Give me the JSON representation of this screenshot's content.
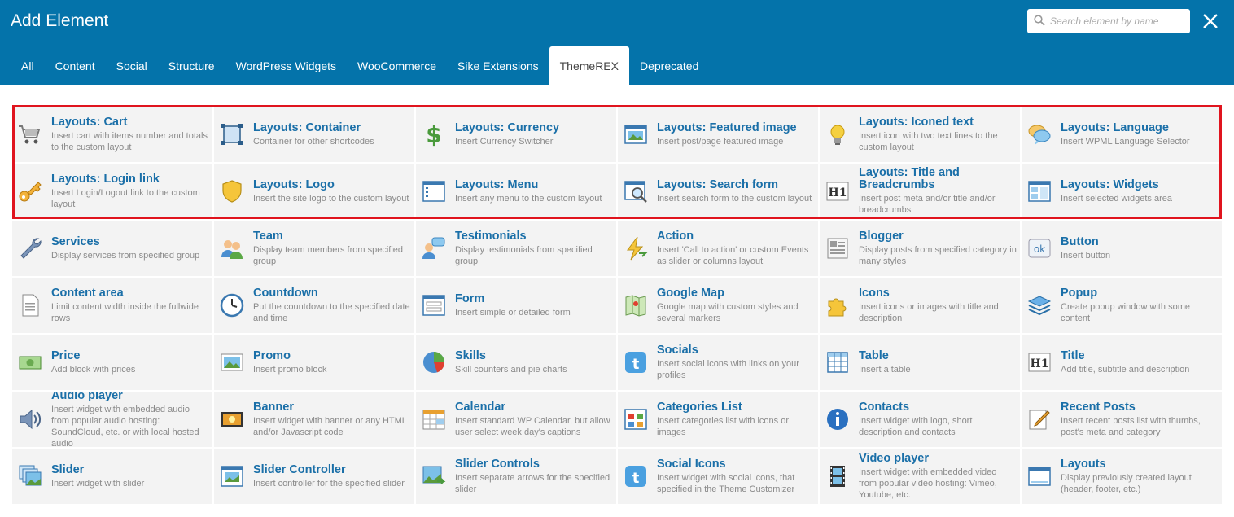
{
  "header": {
    "title": "Add Element",
    "search_placeholder": "Search element by name"
  },
  "tabs": [
    "All",
    "Content",
    "Social",
    "Structure",
    "WordPress Widgets",
    "WooCommerce",
    "Sike Extensions",
    "ThemeREX",
    "Deprecated"
  ],
  "active_tab": "ThemeREX",
  "colors": {
    "header": "#0473aa",
    "link": "#1a6fa8",
    "highlight": "#e0141e"
  },
  "elements": [
    {
      "name": "Layouts: Cart",
      "desc": "Insert cart with items number and totals to the custom layout",
      "icon": "cart-icon"
    },
    {
      "name": "Layouts: Container",
      "desc": "Container for other shortcodes",
      "icon": "container-icon"
    },
    {
      "name": "Layouts: Currency",
      "desc": "Insert Currency Switcher",
      "icon": "dollar-icon"
    },
    {
      "name": "Layouts: Featured image",
      "desc": "Insert post/page featured image",
      "icon": "image-window-icon"
    },
    {
      "name": "Layouts: Iconed text",
      "desc": "Insert icon with two text lines to the custom layout",
      "icon": "bulb-icon"
    },
    {
      "name": "Layouts: Language",
      "desc": "Insert WPML Language Selector",
      "icon": "speech-bubbles-icon"
    },
    {
      "name": "Layouts: Login link",
      "desc": "Insert Login/Logout link to the custom layout",
      "icon": "key-icon"
    },
    {
      "name": "Layouts: Logo",
      "desc": "Insert the site logo to the custom layout",
      "icon": "shield-icon"
    },
    {
      "name": "Layouts: Menu",
      "desc": "Insert any menu to the custom layout",
      "icon": "menu-window-icon"
    },
    {
      "name": "Layouts: Search form",
      "desc": "Insert search form to the custom layout",
      "icon": "search-window-icon"
    },
    {
      "name": "Layouts: Title and Breadcrumbs",
      "desc": "Insert post meta and/or title and/or breadcrumbs",
      "icon": "h1-icon"
    },
    {
      "name": "Layouts: Widgets",
      "desc": "Insert selected widgets area",
      "icon": "widgets-window-icon"
    },
    {
      "name": "Services",
      "desc": "Display services from specified group",
      "icon": "wrench-icon"
    },
    {
      "name": "Team",
      "desc": "Display team members from specified group",
      "icon": "users-icon"
    },
    {
      "name": "Testimonials",
      "desc": "Display testimonials from specified group",
      "icon": "user-comment-icon"
    },
    {
      "name": "Action",
      "desc": "Insert 'Call to action' or custom Events as slider or columns layout",
      "icon": "lightning-icon"
    },
    {
      "name": "Blogger",
      "desc": "Display posts from specified category in many styles",
      "icon": "newspaper-icon"
    },
    {
      "name": "Button",
      "desc": "Insert button",
      "icon": "ok-button-icon"
    },
    {
      "name": "Content area",
      "desc": "Limit content width inside the fullwide rows",
      "icon": "document-icon"
    },
    {
      "name": "Countdown",
      "desc": "Put the countdown to the specified date and time",
      "icon": "clock-icon"
    },
    {
      "name": "Form",
      "desc": "Insert simple or detailed form",
      "icon": "form-window-icon"
    },
    {
      "name": "Google Map",
      "desc": "Google map with custom styles and several markers",
      "icon": "map-icon"
    },
    {
      "name": "Icons",
      "desc": "Insert icons or images with title and description",
      "icon": "puzzle-icon"
    },
    {
      "name": "Popup",
      "desc": "Create popup window with some content",
      "icon": "layers-icon"
    },
    {
      "name": "Price",
      "desc": "Add block with prices",
      "icon": "money-icon"
    },
    {
      "name": "Promo",
      "desc": "Insert promo block",
      "icon": "picture-icon"
    },
    {
      "name": "Skills",
      "desc": "Skill counters and pie charts",
      "icon": "pie-chart-icon"
    },
    {
      "name": "Socials",
      "desc": "Insert social icons with links on your profiles",
      "icon": "twitter-icon"
    },
    {
      "name": "Table",
      "desc": "Insert a table",
      "icon": "table-icon"
    },
    {
      "name": "Title",
      "desc": "Add title, subtitle and description",
      "icon": "h1-icon"
    },
    {
      "name": "Audio player",
      "desc": "Insert widget with embedded audio from popular audio hosting: SoundCloud, etc. or with local hosted audio",
      "icon": "speaker-icon"
    },
    {
      "name": "Banner",
      "desc": "Insert widget with banner or any HTML and/or Javascript code",
      "icon": "banner-icon"
    },
    {
      "name": "Calendar",
      "desc": "Insert standard WP Calendar, but allow user select week day's captions",
      "icon": "calendar-icon"
    },
    {
      "name": "Categories List",
      "desc": "Insert categories list with icons or images",
      "icon": "categories-icon"
    },
    {
      "name": "Contacts",
      "desc": "Insert widget with logo, short description and contacts",
      "icon": "info-icon"
    },
    {
      "name": "Recent Posts",
      "desc": "Insert recent posts list with thumbs, post's meta and category",
      "icon": "pen-paper-icon"
    },
    {
      "name": "Slider",
      "desc": "Insert widget with slider",
      "icon": "slides-icon"
    },
    {
      "name": "Slider Controller",
      "desc": "Insert controller for the specified slider",
      "icon": "slider-window-icon"
    },
    {
      "name": "Slider Controls",
      "desc": "Insert separate arrows for the specified slider",
      "icon": "slider-arrows-icon"
    },
    {
      "name": "Social Icons",
      "desc": "Insert widget with social icons, that specified in the Theme Customizer",
      "icon": "twitter-icon"
    },
    {
      "name": "Video player",
      "desc": "Insert widget with embedded video from popular video hosting: Vimeo, Youtube, etc.",
      "icon": "film-icon"
    },
    {
      "name": "Layouts",
      "desc": "Display previously created layout (header, footer, etc.)",
      "icon": "layout-window-icon"
    }
  ]
}
